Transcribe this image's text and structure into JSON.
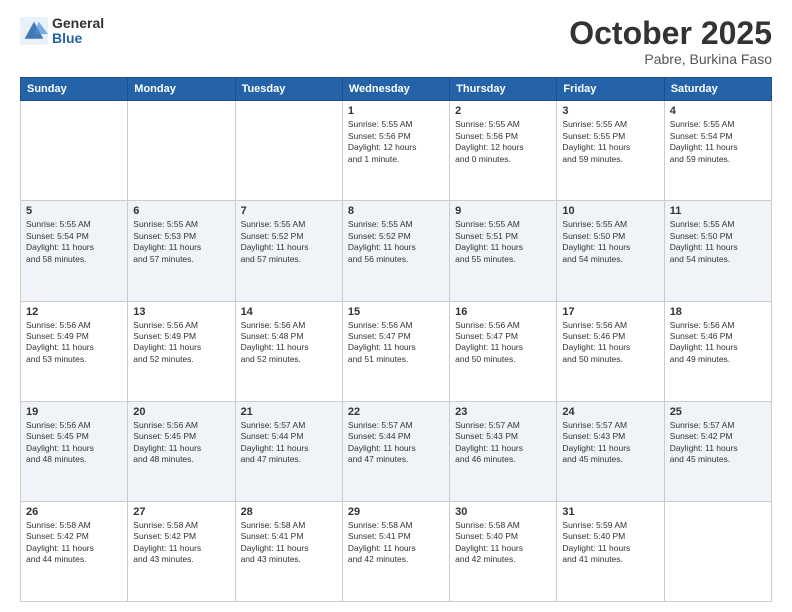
{
  "header": {
    "logo_general": "General",
    "logo_blue": "Blue",
    "month": "October 2025",
    "location": "Pabre, Burkina Faso"
  },
  "weekdays": [
    "Sunday",
    "Monday",
    "Tuesday",
    "Wednesday",
    "Thursday",
    "Friday",
    "Saturday"
  ],
  "rows": [
    {
      "alt": false,
      "cells": [
        {
          "day": "",
          "info": ""
        },
        {
          "day": "",
          "info": ""
        },
        {
          "day": "",
          "info": ""
        },
        {
          "day": "1",
          "info": "Sunrise: 5:55 AM\nSunset: 5:56 PM\nDaylight: 12 hours\nand 1 minute."
        },
        {
          "day": "2",
          "info": "Sunrise: 5:55 AM\nSunset: 5:56 PM\nDaylight: 12 hours\nand 0 minutes."
        },
        {
          "day": "3",
          "info": "Sunrise: 5:55 AM\nSunset: 5:55 PM\nDaylight: 11 hours\nand 59 minutes."
        },
        {
          "day": "4",
          "info": "Sunrise: 5:55 AM\nSunset: 5:54 PM\nDaylight: 11 hours\nand 59 minutes."
        }
      ]
    },
    {
      "alt": true,
      "cells": [
        {
          "day": "5",
          "info": "Sunrise: 5:55 AM\nSunset: 5:54 PM\nDaylight: 11 hours\nand 58 minutes."
        },
        {
          "day": "6",
          "info": "Sunrise: 5:55 AM\nSunset: 5:53 PM\nDaylight: 11 hours\nand 57 minutes."
        },
        {
          "day": "7",
          "info": "Sunrise: 5:55 AM\nSunset: 5:52 PM\nDaylight: 11 hours\nand 57 minutes."
        },
        {
          "day": "8",
          "info": "Sunrise: 5:55 AM\nSunset: 5:52 PM\nDaylight: 11 hours\nand 56 minutes."
        },
        {
          "day": "9",
          "info": "Sunrise: 5:55 AM\nSunset: 5:51 PM\nDaylight: 11 hours\nand 55 minutes."
        },
        {
          "day": "10",
          "info": "Sunrise: 5:55 AM\nSunset: 5:50 PM\nDaylight: 11 hours\nand 54 minutes."
        },
        {
          "day": "11",
          "info": "Sunrise: 5:55 AM\nSunset: 5:50 PM\nDaylight: 11 hours\nand 54 minutes."
        }
      ]
    },
    {
      "alt": false,
      "cells": [
        {
          "day": "12",
          "info": "Sunrise: 5:56 AM\nSunset: 5:49 PM\nDaylight: 11 hours\nand 53 minutes."
        },
        {
          "day": "13",
          "info": "Sunrise: 5:56 AM\nSunset: 5:49 PM\nDaylight: 11 hours\nand 52 minutes."
        },
        {
          "day": "14",
          "info": "Sunrise: 5:56 AM\nSunset: 5:48 PM\nDaylight: 11 hours\nand 52 minutes."
        },
        {
          "day": "15",
          "info": "Sunrise: 5:56 AM\nSunset: 5:47 PM\nDaylight: 11 hours\nand 51 minutes."
        },
        {
          "day": "16",
          "info": "Sunrise: 5:56 AM\nSunset: 5:47 PM\nDaylight: 11 hours\nand 50 minutes."
        },
        {
          "day": "17",
          "info": "Sunrise: 5:56 AM\nSunset: 5:46 PM\nDaylight: 11 hours\nand 50 minutes."
        },
        {
          "day": "18",
          "info": "Sunrise: 5:56 AM\nSunset: 5:46 PM\nDaylight: 11 hours\nand 49 minutes."
        }
      ]
    },
    {
      "alt": true,
      "cells": [
        {
          "day": "19",
          "info": "Sunrise: 5:56 AM\nSunset: 5:45 PM\nDaylight: 11 hours\nand 48 minutes."
        },
        {
          "day": "20",
          "info": "Sunrise: 5:56 AM\nSunset: 5:45 PM\nDaylight: 11 hours\nand 48 minutes."
        },
        {
          "day": "21",
          "info": "Sunrise: 5:57 AM\nSunset: 5:44 PM\nDaylight: 11 hours\nand 47 minutes."
        },
        {
          "day": "22",
          "info": "Sunrise: 5:57 AM\nSunset: 5:44 PM\nDaylight: 11 hours\nand 47 minutes."
        },
        {
          "day": "23",
          "info": "Sunrise: 5:57 AM\nSunset: 5:43 PM\nDaylight: 11 hours\nand 46 minutes."
        },
        {
          "day": "24",
          "info": "Sunrise: 5:57 AM\nSunset: 5:43 PM\nDaylight: 11 hours\nand 45 minutes."
        },
        {
          "day": "25",
          "info": "Sunrise: 5:57 AM\nSunset: 5:42 PM\nDaylight: 11 hours\nand 45 minutes."
        }
      ]
    },
    {
      "alt": false,
      "cells": [
        {
          "day": "26",
          "info": "Sunrise: 5:58 AM\nSunset: 5:42 PM\nDaylight: 11 hours\nand 44 minutes."
        },
        {
          "day": "27",
          "info": "Sunrise: 5:58 AM\nSunset: 5:42 PM\nDaylight: 11 hours\nand 43 minutes."
        },
        {
          "day": "28",
          "info": "Sunrise: 5:58 AM\nSunset: 5:41 PM\nDaylight: 11 hours\nand 43 minutes."
        },
        {
          "day": "29",
          "info": "Sunrise: 5:58 AM\nSunset: 5:41 PM\nDaylight: 11 hours\nand 42 minutes."
        },
        {
          "day": "30",
          "info": "Sunrise: 5:58 AM\nSunset: 5:40 PM\nDaylight: 11 hours\nand 42 minutes."
        },
        {
          "day": "31",
          "info": "Sunrise: 5:59 AM\nSunset: 5:40 PM\nDaylight: 11 hours\nand 41 minutes."
        },
        {
          "day": "",
          "info": ""
        }
      ]
    }
  ]
}
